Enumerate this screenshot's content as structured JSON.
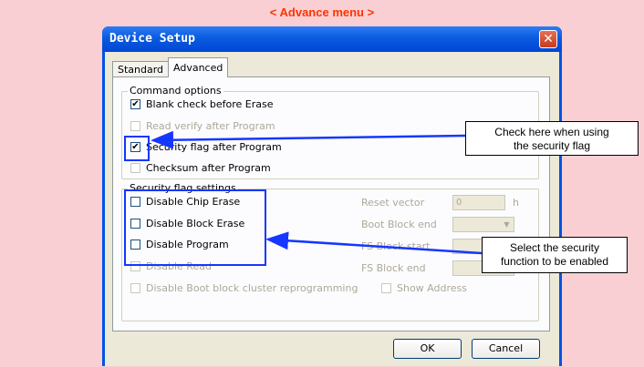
{
  "caption": "< Advance menu >",
  "window": {
    "title": "Device Setup",
    "close": "✕"
  },
  "tabs": [
    {
      "label": "Standard",
      "active": false
    },
    {
      "label": "Advanced",
      "active": true
    }
  ],
  "command_options": {
    "title": "Command options",
    "items": [
      {
        "label": "Blank check before Erase",
        "checked": true,
        "enabled": true
      },
      {
        "label": "Read verify after Program",
        "checked": false,
        "enabled": false
      },
      {
        "label": "Security flag after Program",
        "checked": true,
        "enabled": true
      },
      {
        "label": "Checksum after Program",
        "checked": false,
        "enabled": false
      }
    ]
  },
  "security_settings": {
    "title": "Security flag settings",
    "items": [
      {
        "label": "Disable Chip Erase",
        "checked": false,
        "enabled": true
      },
      {
        "label": "Disable Block Erase",
        "checked": false,
        "enabled": true
      },
      {
        "label": "Disable Program",
        "checked": false,
        "enabled": true
      },
      {
        "label": "Disable Read",
        "checked": false,
        "enabled": false
      },
      {
        "label": "Disable Boot block cluster reprogramming",
        "checked": false,
        "enabled": false
      }
    ],
    "reset_vector": {
      "label": "Reset vector",
      "value": "0",
      "unit": "h"
    },
    "boot_block_end": {
      "label": "Boot Block end"
    },
    "fs_block_start": {
      "label": "FS Block start"
    },
    "fs_block_end": {
      "label": "FS Block end"
    },
    "show_address": {
      "label": "Show Address",
      "checked": false
    }
  },
  "buttons": {
    "ok": "OK",
    "cancel": "Cancel"
  },
  "callouts": {
    "security_flag": {
      "line1": "Check here when using",
      "line2": "the security flag"
    },
    "security_function": {
      "line1": "Select the security",
      "line2": "function to be enabled"
    }
  },
  "colors": {
    "background": "#f9cfd3",
    "caption": "#ff3300",
    "highlight": "#1537ff",
    "title_bar": "#0054e3"
  }
}
